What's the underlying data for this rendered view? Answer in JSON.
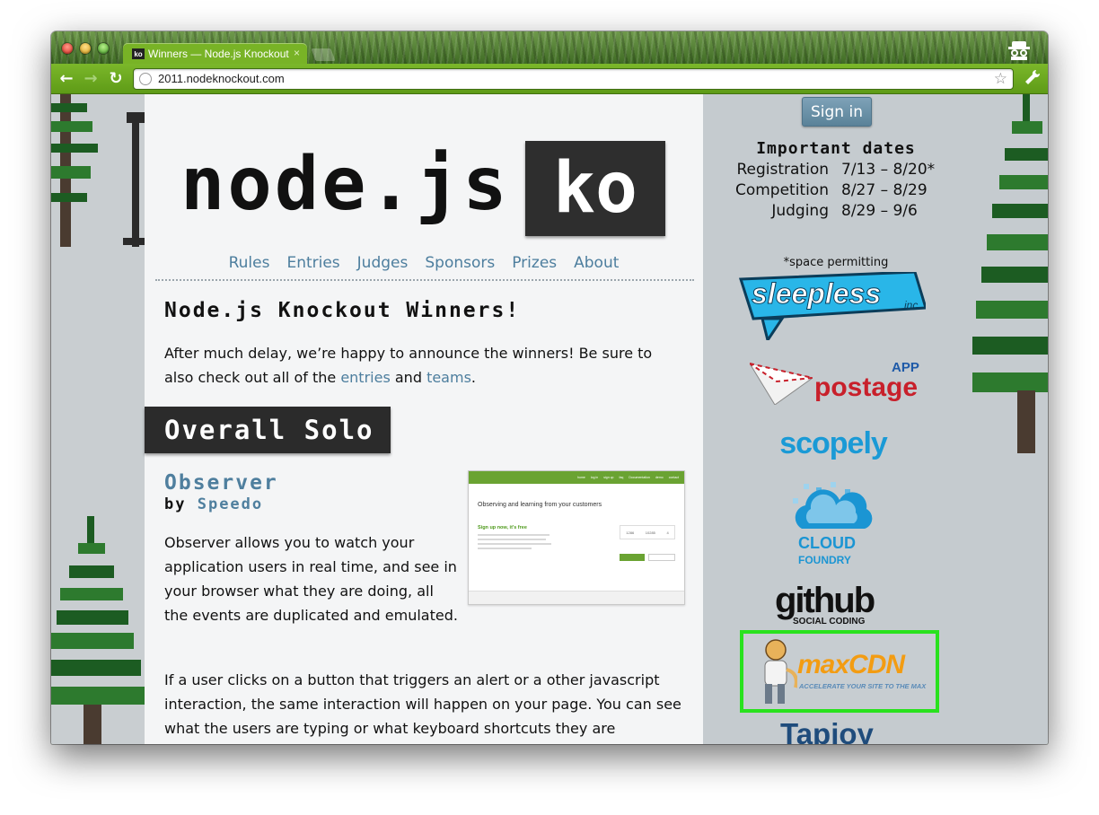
{
  "browser": {
    "tab_title": "Winners — Node.js Knockout",
    "tab_favicon": "ko",
    "tab_close": "×",
    "url": "2011.nodeknockout.com",
    "back_glyph": "←",
    "forward_glyph": "→",
    "reload_glyph": "↻",
    "star_glyph": "☆",
    "wrench_glyph": "🔧"
  },
  "logo": {
    "text": "node.js",
    "badge": "ko"
  },
  "nav": [
    "Rules",
    "Entries",
    "Judges",
    "Sponsors",
    "Prizes",
    "About"
  ],
  "page": {
    "heading": "Node.js Knockout Winners!",
    "intro_before": "After much delay, we’re happy to announce the winners! Be sure to also check out all of the ",
    "intro_link1": "entries",
    "intro_mid": " and ",
    "intro_link2": "teams",
    "intro_after": "."
  },
  "section": {
    "banner": "Overall Solo"
  },
  "entry": {
    "title": "Observer",
    "by": "by ",
    "team": "Speedo",
    "description": "Observer allows you to watch your application users in real time, and see in your browser what they are doing, all the events are duplicated and emulated.",
    "description2": "If a user clicks on a button that triggers an alert or a other javascript interaction, the same interaction will happen on your page. You can see what the users are typing or what keyboard shortcuts they are",
    "thumbnail": {
      "nav": [
        "home",
        "log in",
        "sign up",
        "faq",
        "Documentation",
        "demo",
        "contact"
      ],
      "headline": "Observing and learning from your customers",
      "signup": "Sign up now, it's free",
      "stats": [
        "1286",
        "10285",
        "4"
      ]
    }
  },
  "sidebar": {
    "signin": "Sign in",
    "dates_heading": "Important dates",
    "dates": [
      {
        "label": "Registration",
        "value": "7/13 – 8/20*"
      },
      {
        "label": "Competition",
        "value": "8/27 – 8/29"
      },
      {
        "label": "Judging",
        "value": "8/29 – 9/6"
      }
    ],
    "dates_note": "*space permitting",
    "sponsors": {
      "sleepless": "sleepless",
      "sleepless_inc": "inc.",
      "postage_app": "APP",
      "postage": "postage",
      "scopely": "scopely",
      "cloud": "CLOUD",
      "foundry": "FOUNDRY",
      "github": "github",
      "github_sub": "SOCIAL CODING",
      "maxcdn": "maxCDN",
      "maxcdn_tag": "ACCELERATE YOUR SITE TO THE MAX",
      "tapjoy": "Tapjoy"
    }
  },
  "colors": {
    "link": "#4d7e9e",
    "chrome_green": "#6aa82a",
    "maxcdn_highlight": "#29e21e",
    "scopely": "#1a9ad6",
    "postage": "#c8202b"
  }
}
